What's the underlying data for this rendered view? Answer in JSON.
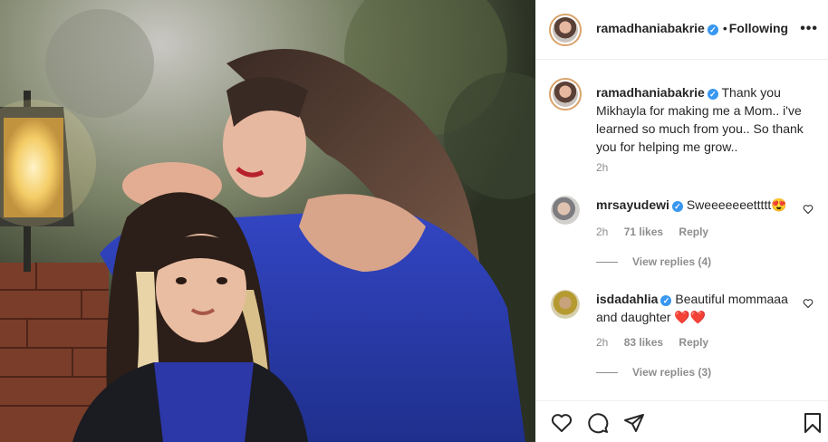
{
  "post": {
    "author": "ramadhaniabakrie",
    "follow_status": "Following",
    "more_label": "•••"
  },
  "caption": {
    "username": "ramadhaniabakrie",
    "text": "Thank you Mikhayla for making me a Mom.. i've learned so much from you.. So thank you for helping me grow..",
    "time": "2h"
  },
  "comments": [
    {
      "username": "mrsayudewi",
      "text": "Sweeeeeeettttt",
      "emoji": "😍",
      "time": "2h",
      "likes": "71 likes",
      "reply_label": "Reply",
      "view_replies": "View replies (4)"
    },
    {
      "username": "isdadahlia",
      "text": "Beautiful mommaaa and daughter",
      "emoji": "❤️❤️",
      "time": "2h",
      "likes": "83 likes",
      "reply_label": "Reply",
      "view_replies": "View replies (3)"
    }
  ],
  "icons": [
    "like-heart-icon",
    "comment-icon",
    "share-icon",
    "save-bookmark-icon",
    "more-options-icon",
    "verified-icon"
  ],
  "colors": {
    "accent_blue": "#3897f0",
    "sweater_blue": "#2a3fb0",
    "text": "#262626",
    "muted": "#8e8e8e"
  }
}
